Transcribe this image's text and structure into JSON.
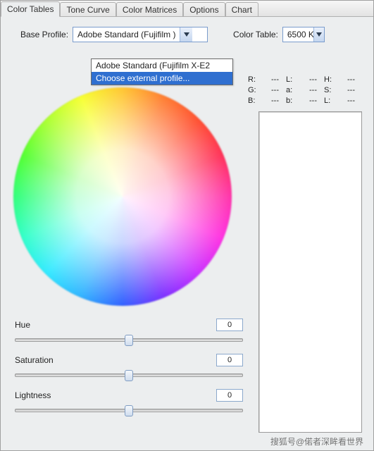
{
  "tabs": {
    "items": [
      "Color Tables",
      "Tone Curve",
      "Color Matrices",
      "Options",
      "Chart"
    ],
    "active_index": 0
  },
  "labels": {
    "base_profile": "Base Profile:",
    "color_table": "Color Table:"
  },
  "base_profile": {
    "selected": "Adobe Standard (Fujifilm )",
    "options": [
      {
        "text": "Adobe Standard (Fujifilm X-E2",
        "highlighted": false
      },
      {
        "text": "Choose external profile...",
        "highlighted": true
      }
    ]
  },
  "color_table_combo": {
    "selected": "6500 K"
  },
  "readout": {
    "rows": [
      {
        "a": "R:",
        "av": "---",
        "b": "L:",
        "bv": "---",
        "c": "H:",
        "cv": "---"
      },
      {
        "a": "G:",
        "av": "---",
        "b": "a:",
        "bv": "---",
        "c": "S:",
        "cv": "---"
      },
      {
        "a": "B:",
        "av": "---",
        "b": "b:",
        "bv": "---",
        "c": "L:",
        "cv": "---"
      }
    ]
  },
  "sliders": {
    "hue": {
      "label": "Hue",
      "value": "0",
      "pos_pct": 50
    },
    "saturation": {
      "label": "Saturation",
      "value": "0",
      "pos_pct": 50
    },
    "lightness": {
      "label": "Lightness",
      "value": "0",
      "pos_pct": 50
    }
  },
  "watermark": "搜狐号@偌者深眸看世界"
}
